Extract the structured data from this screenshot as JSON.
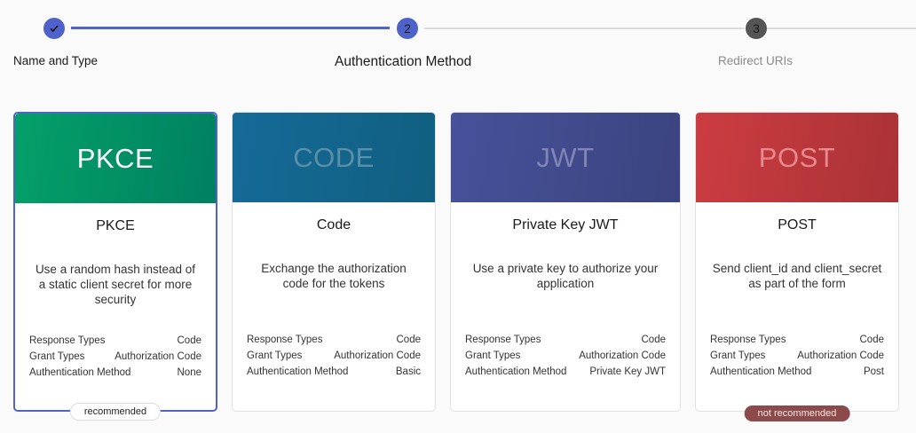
{
  "stepper": {
    "steps": [
      {
        "number": "",
        "label": "Name and Type",
        "state": "complete",
        "icon": "check-icon"
      },
      {
        "number": "2",
        "label": "Authentication Method",
        "state": "active"
      },
      {
        "number": "3",
        "label": "Redirect URIs",
        "state": "pending"
      }
    ]
  },
  "cards": [
    {
      "banner": "PKCE",
      "title": "PKCE",
      "description": "Use a random hash instead of a static client secret for more security",
      "properties": [
        {
          "label": "Response Types",
          "value": "Code"
        },
        {
          "label": "Grant Types",
          "value": "Authorization Code"
        },
        {
          "label": "Authentication Method",
          "value": "None"
        }
      ],
      "badge": "recommended",
      "selected": true,
      "banner_text_color": "#ffffff"
    },
    {
      "banner": "CODE",
      "title": "Code",
      "description": "Exchange the authorization code for the tokens",
      "properties": [
        {
          "label": "Response Types",
          "value": "Code"
        },
        {
          "label": "Grant Types",
          "value": "Authorization Code"
        },
        {
          "label": "Authentication Method",
          "value": "Basic"
        }
      ],
      "badge": "",
      "selected": false,
      "banner_text_color": "#5b8fa9"
    },
    {
      "banner": "JWT",
      "title": "Private Key JWT",
      "description": "Use a private key to authorize your application",
      "properties": [
        {
          "label": "Response Types",
          "value": "Code"
        },
        {
          "label": "Grant Types",
          "value": "Authorization Code"
        },
        {
          "label": "Authentication Method",
          "value": "Private Key JWT"
        }
      ],
      "badge": "",
      "selected": false,
      "banner_text_color": "#7f86b3"
    },
    {
      "banner": "POST",
      "title": "POST",
      "description": "Send client_id and client_secret as part of the form",
      "properties": [
        {
          "label": "Response Types",
          "value": "Code"
        },
        {
          "label": "Grant Types",
          "value": "Authorization Code"
        },
        {
          "label": "Authentication Method",
          "value": "Post"
        }
      ],
      "badge": "not recommended",
      "selected": false,
      "banner_text_color": "#e88a8d"
    }
  ],
  "colors": {
    "accent": "#5063c8",
    "pkce": "#04a069",
    "code": "#156a98",
    "jwt": "#46519a",
    "post": "#cc3c42"
  }
}
